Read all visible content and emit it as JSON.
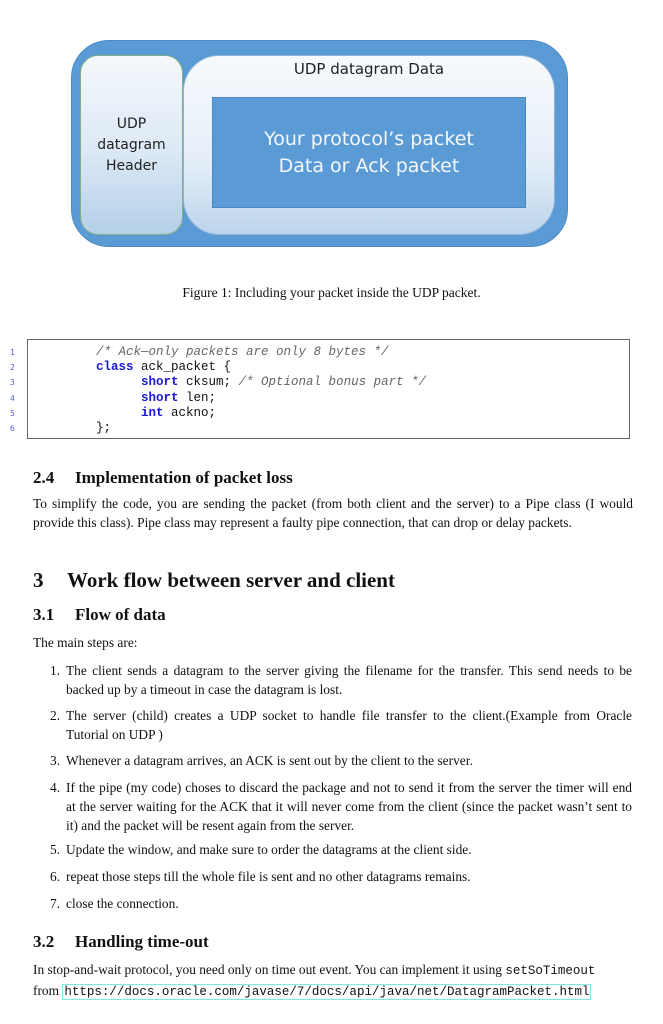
{
  "figure": {
    "header_label": "UDP datagram Header",
    "header_lines": [
      "UDP",
      "datagram",
      "Header"
    ],
    "data_title": "UDP datagram Data",
    "packet_lines": [
      "Your protocol’s packet",
      "Data or Ack packet"
    ],
    "caption": "Figure 1: Including your packet inside the UDP packet."
  },
  "code": {
    "line_numbers": [
      "1",
      "2",
      "3",
      "4",
      "5",
      "6"
    ],
    "lines": [
      {
        "indent": "",
        "parts": [
          {
            "t": "/* Ack—only packets are only 8 bytes */",
            "c": "cm"
          }
        ]
      },
      {
        "indent": "",
        "parts": [
          {
            "t": "class",
            "c": "kw"
          },
          {
            "t": " ack_packet {",
            "c": ""
          }
        ]
      },
      {
        "indent": "      ",
        "parts": [
          {
            "t": "short",
            "c": "kw"
          },
          {
            "t": " cksum; ",
            "c": ""
          },
          {
            "t": "/* Optional bonus part */",
            "c": "cm"
          }
        ]
      },
      {
        "indent": "      ",
        "parts": [
          {
            "t": "short",
            "c": "kw"
          },
          {
            "t": " len;",
            "c": ""
          }
        ]
      },
      {
        "indent": "      ",
        "parts": [
          {
            "t": "int",
            "c": "kw"
          },
          {
            "t": " ackno;",
            "c": ""
          }
        ]
      },
      {
        "indent": "",
        "parts": [
          {
            "t": "};",
            "c": ""
          }
        ]
      }
    ]
  },
  "section_2_4": {
    "number": "2.4",
    "title": "Implementation of packet loss",
    "body": "To simplify the code, you are sending the packet (from both client and the server) to a Pipe class (I would provide this class). Pipe class may represent a faulty pipe connection, that can drop or delay packets."
  },
  "section_3": {
    "number": "3",
    "title": "Work flow between server and client"
  },
  "section_3_1": {
    "number": "3.1",
    "title": "Flow of data",
    "intro": "The main steps are:",
    "steps": [
      {
        "n": "1.",
        "text": "The client sends a datagram to the server giving the filename for the transfer.  This send needs to be backed up by a timeout in case the datagram is lost."
      },
      {
        "n": "2.",
        "text": "The server (child) creates a UDP socket to handle file transfer to the client.(Example from Oracle Tutorial on UDP )"
      },
      {
        "n": "3.",
        "text": "Whenever a datagram arrives, an ACK is sent out by the client to the server."
      },
      {
        "n": "4.",
        "text": "If the pipe (my code) choses to discard the package and not to send it from the server the timer will end at the server waiting for the ACK that it will never come from the client (since the packet wasn’t sent to it) and the packet will be resent again from the server."
      },
      {
        "n": "5.",
        "text": "Update the window, and make sure to order the datagrams at the client side."
      },
      {
        "n": "6.",
        "text": "repeat those steps till the whole file is sent and no other datagrams remains."
      },
      {
        "n": "7.",
        "text": "close the connection."
      }
    ]
  },
  "section_3_2": {
    "number": "3.2",
    "title": "Handling time-out",
    "body_pre": "In stop-and-wait protocol, you need only on time out event.  You can implement it using ",
    "code_term": "setSoTimeout",
    "body_mid": "from ",
    "url": "https://docs.oracle.com/javase/7/docs/api/java/net/DatagramPacket.html"
  }
}
